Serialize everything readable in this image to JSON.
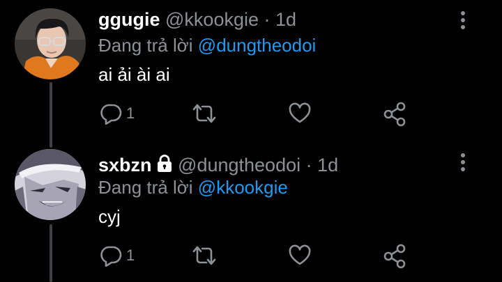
{
  "colors": {
    "background": "#000000",
    "accent": "#1d9bf0",
    "muted": "#8b9196",
    "thread_line": "#3d4044"
  },
  "tweets": [
    {
      "display_name": "ggugie",
      "handle": "@kkookgie",
      "separator": "·",
      "time": "1d",
      "reply_prefix": "Đang trả lời",
      "reply_to": "@dungtheodoi",
      "text": "ai ải ài ai",
      "reply_count": "1",
      "locked": false,
      "icons": [
        "comment-icon",
        "retweet-icon",
        "heart-icon",
        "share-icon",
        "more-icon"
      ]
    },
    {
      "display_name": "sxbzn",
      "handle": "@dungtheodoi",
      "separator": "·",
      "time": "1d",
      "reply_prefix": "Đang trả lời",
      "reply_to": "@kkookgie",
      "text": "cyj",
      "reply_count": "1",
      "locked": true,
      "icons": [
        "comment-icon",
        "retweet-icon",
        "heart-icon",
        "share-icon",
        "more-icon"
      ]
    }
  ]
}
